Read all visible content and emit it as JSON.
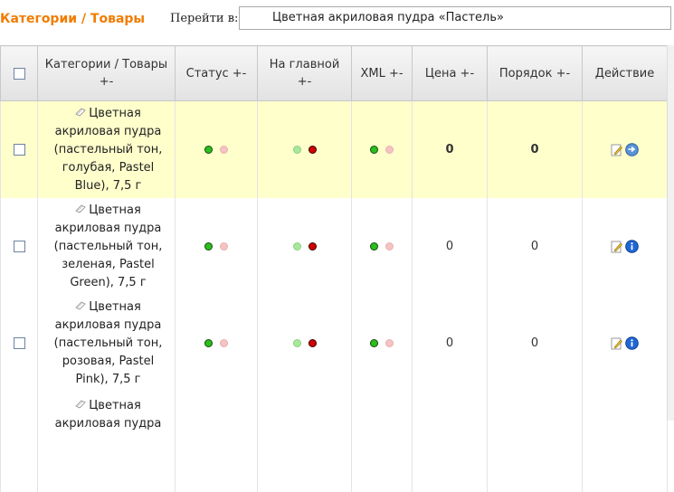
{
  "breadcrumb": "Категории / Товары",
  "goto": {
    "label": "Перейти в:",
    "value": "Цветная акриловая пудра «Пастель»"
  },
  "columns": {
    "name": "Категории / Товары +-",
    "status": "Статус +-",
    "home": "На главной +-",
    "xml": "XML +-",
    "price": "Цена +-",
    "order": "Порядок +-",
    "action": "Действие"
  },
  "rows": [
    {
      "name": "Цветная акриловая пудра (пастельный тон, голубая, Pastel Blue), 7,5 г",
      "price": "0",
      "order": "0"
    },
    {
      "name": "Цветная акриловая пудра (пастельный тон, зеленая, Pastel Green), 7,5 г",
      "price": "0",
      "order": "0"
    },
    {
      "name": "Цветная акриловая пудра (пастельный тон, розовая, Pastel Pink), 7,5 г",
      "price": "0",
      "order": "0"
    },
    {
      "name": "Цветная акриловая пудра",
      "price": "",
      "order": ""
    }
  ],
  "colors": {
    "accent": "#f07c00",
    "highlight_row": "#ffffcc"
  },
  "icons": [
    "checkbox",
    "document-icon",
    "edit-icon",
    "arrow-icon",
    "info-icon",
    "green-dot",
    "red-dot"
  ]
}
